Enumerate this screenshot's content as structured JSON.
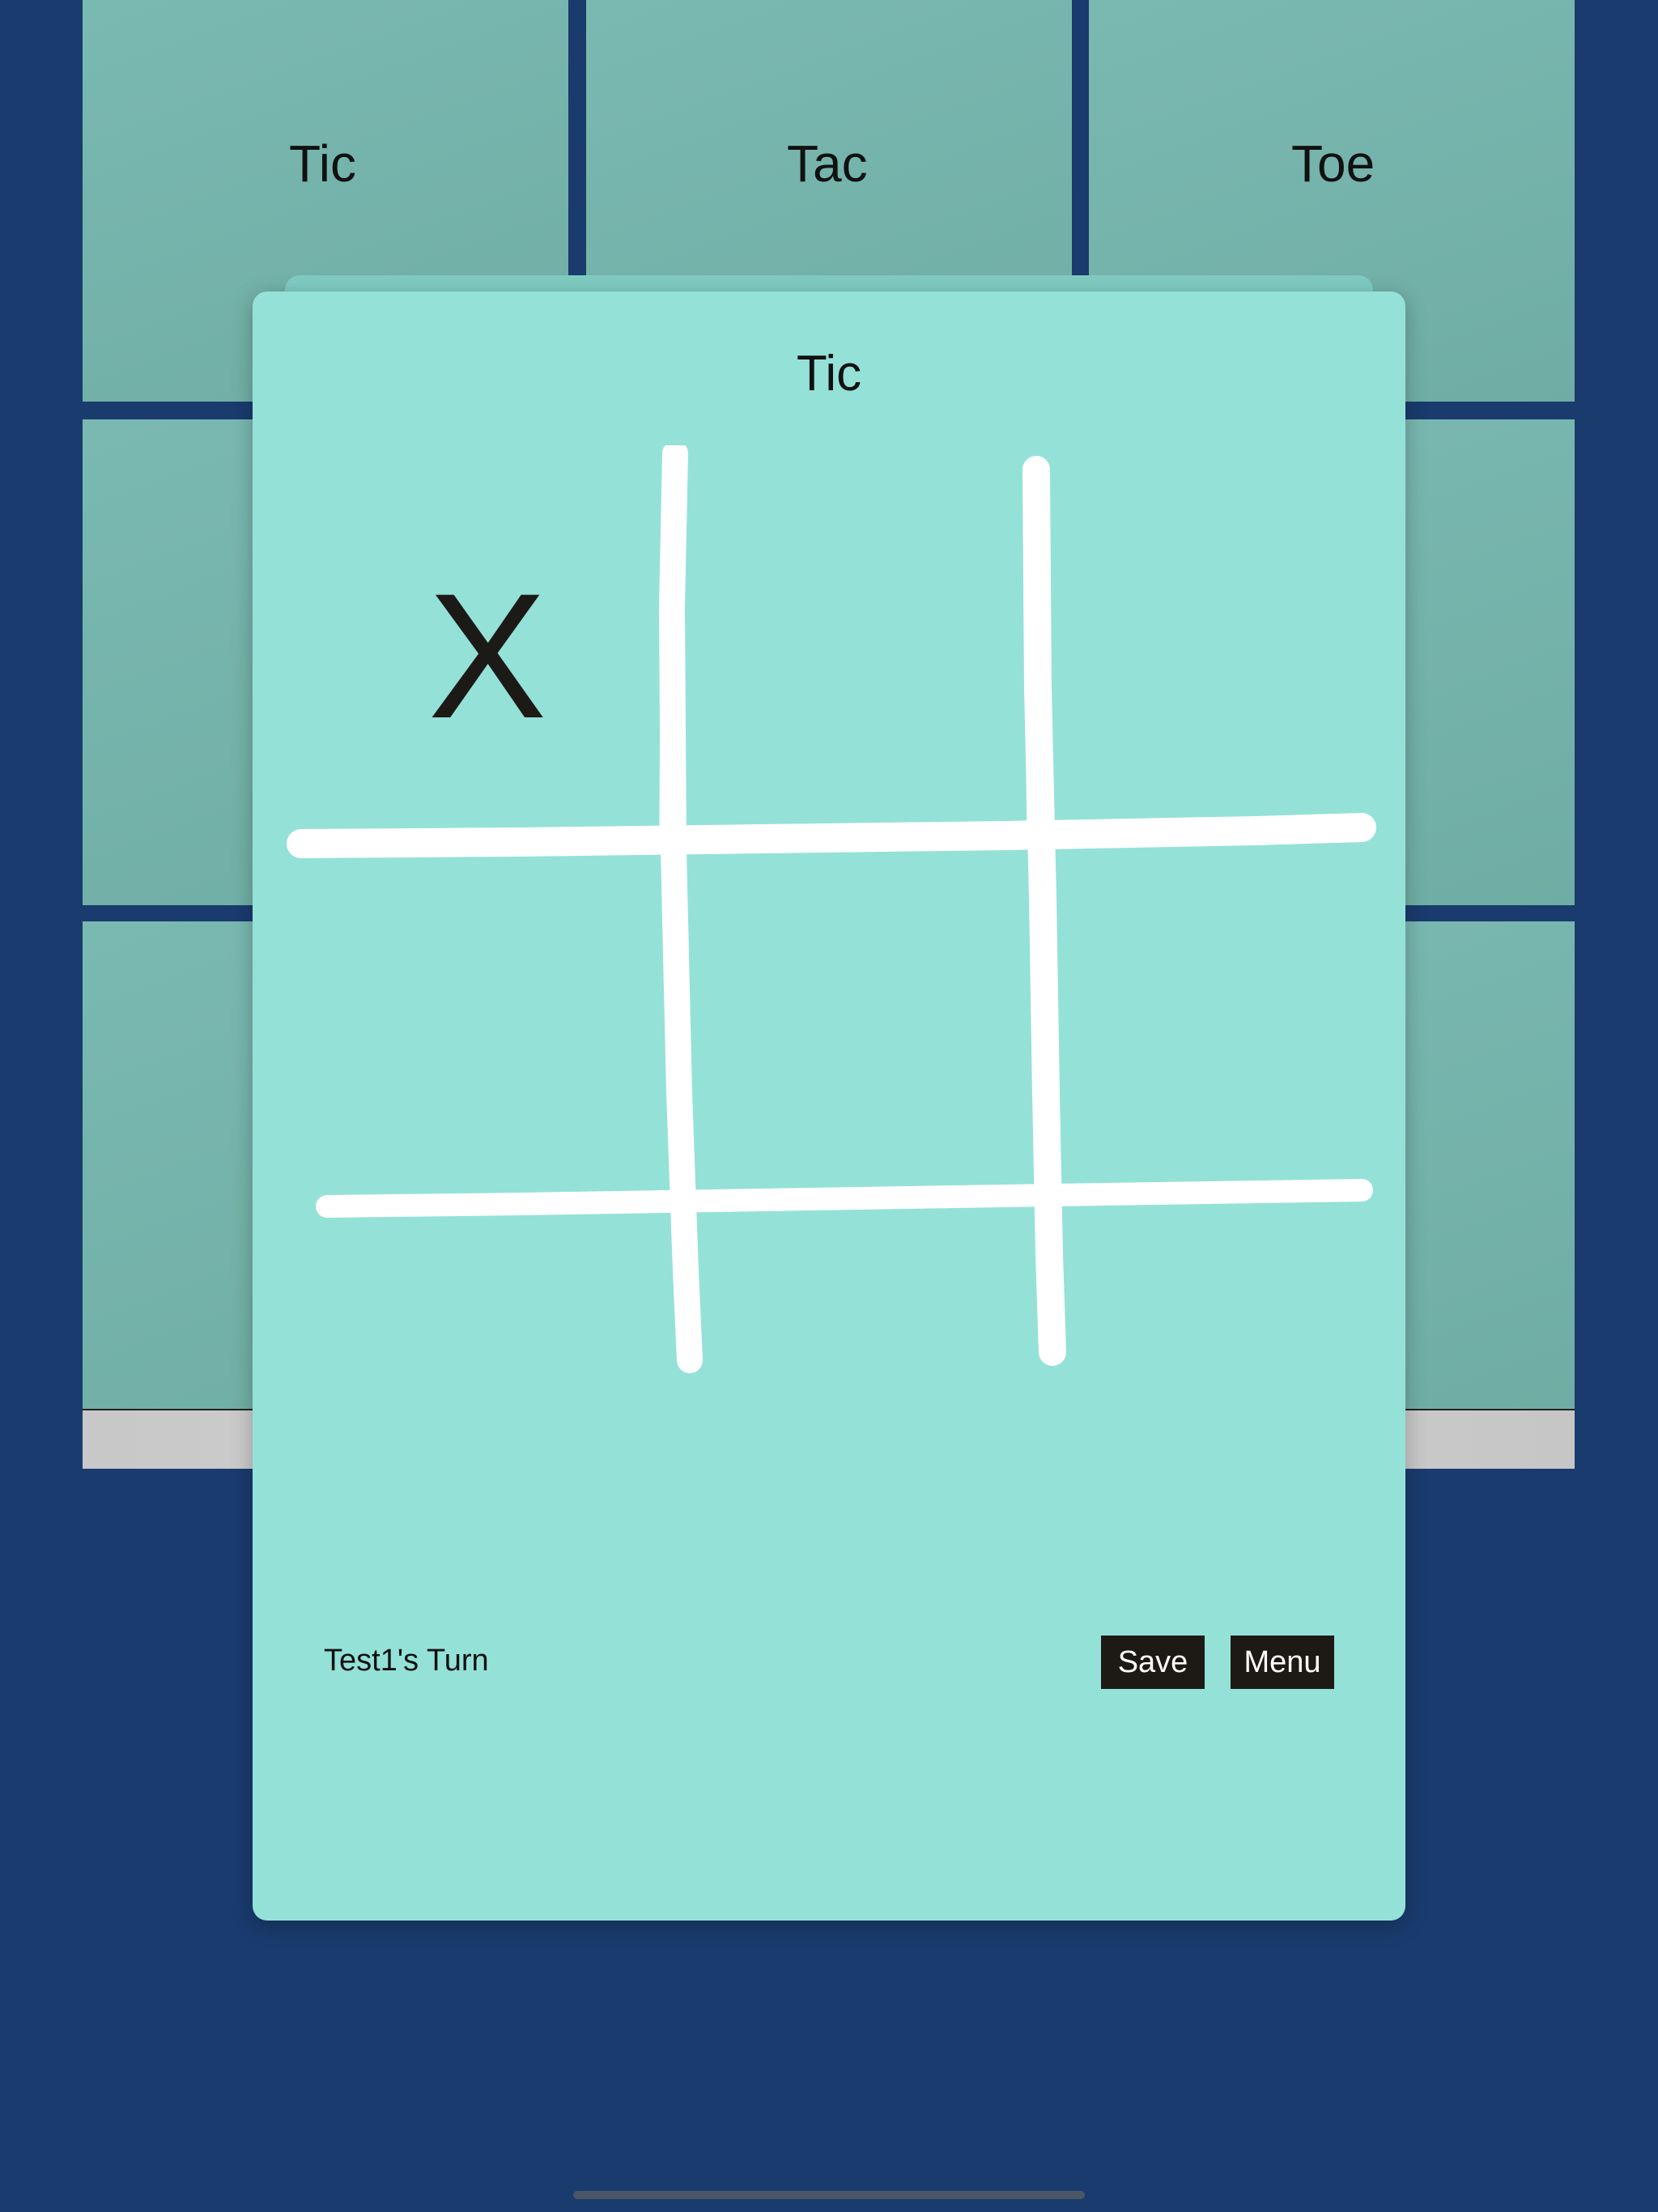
{
  "background_board": {
    "cells": [
      {
        "label": "Tic"
      },
      {
        "label": "Tac"
      },
      {
        "label": "Toe"
      },
      {
        "label": ""
      },
      {
        "label": ""
      },
      {
        "label": ""
      },
      {
        "label": ""
      },
      {
        "label": ""
      },
      {
        "label": ""
      }
    ]
  },
  "modal": {
    "title": "Tic",
    "cells": [
      "X",
      "",
      "",
      "",
      "",
      "",
      "",
      "",
      ""
    ],
    "turn_text": "Test1's Turn",
    "save_label": "Save",
    "menu_label": "Menu"
  },
  "colors": {
    "background": "#1a3b6e",
    "tile": "#77b5ad",
    "card": "#94e1d8",
    "chalk": "#ffffff",
    "button": "#1d1a15"
  }
}
